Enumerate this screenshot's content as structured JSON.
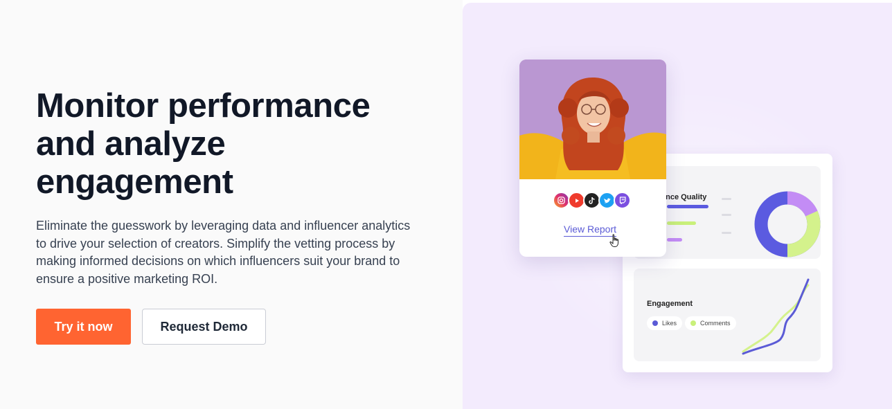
{
  "hero": {
    "title_lines": [
      "Monitor performance",
      "and analyze",
      "engagement"
    ],
    "description": "Eliminate the guesswork by leveraging data and influencer analytics to drive your selection of creators. Simplify the vetting process by making informed decisions on which influencers suit your brand to ensure a positive marketing ROI."
  },
  "buttons": {
    "primary_label": "Try it now",
    "secondary_label": "Request Demo"
  },
  "illustration": {
    "profile_card": {
      "view_report_label": "View Report",
      "social_icons": [
        "instagram-icon",
        "youtube-icon",
        "tiktok-icon",
        "twitter-icon",
        "twitch-icon"
      ]
    },
    "audience_quality": {
      "title": "ence Quality"
    },
    "engagement": {
      "title": "Engagement",
      "legend": [
        {
          "label": "Likes",
          "color": "#5b5bd6"
        },
        {
          "label": "Comments",
          "color": "#c9f07a"
        }
      ]
    }
  },
  "colors": {
    "accent_orange": "#ff6431",
    "heading": "#111827",
    "panel_lavender": "#f3ebfd",
    "link_purple": "#5b5bd6",
    "donut_blue": "#5b5be0",
    "donut_green": "#d4f28c",
    "donut_purple": "#c38cf5"
  }
}
